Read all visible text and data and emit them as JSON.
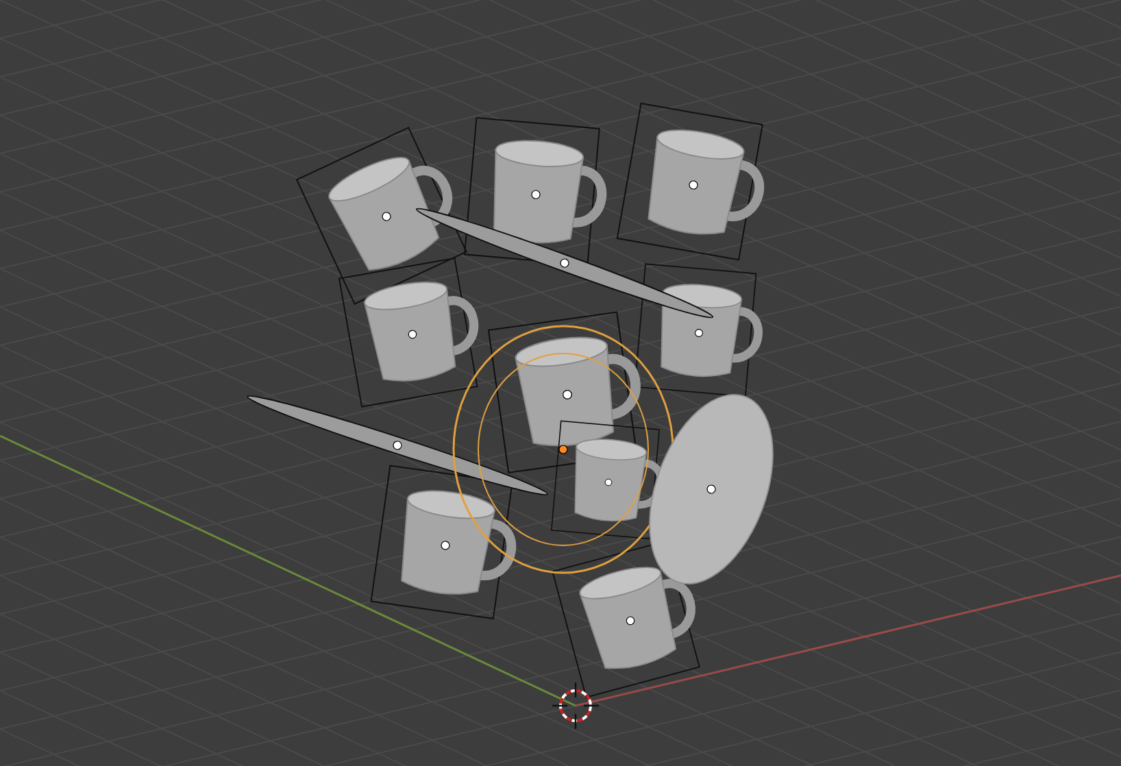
{
  "viewport": {
    "objects": [
      {
        "kind": "cup",
        "selected": false
      },
      {
        "kind": "cup",
        "selected": false
      },
      {
        "kind": "cup",
        "selected": false
      },
      {
        "kind": "saucer",
        "selected": false
      },
      {
        "kind": "cup",
        "selected": false
      },
      {
        "kind": "cup",
        "selected": false
      },
      {
        "kind": "cup",
        "selected": false
      },
      {
        "kind": "saucer",
        "selected": false
      },
      {
        "kind": "saucer",
        "selected": true
      },
      {
        "kind": "cup",
        "selected": false
      },
      {
        "kind": "saucer",
        "selected": false
      },
      {
        "kind": "cup",
        "selected": false
      },
      {
        "kind": "cup",
        "selected": false
      }
    ]
  }
}
